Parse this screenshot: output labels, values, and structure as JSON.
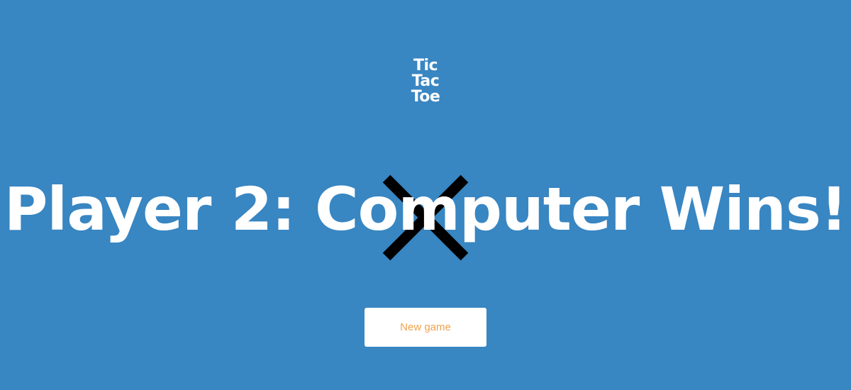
{
  "logo": {
    "lines": [
      "Tic",
      "Tac",
      "Toe"
    ]
  },
  "board": {
    "mark": "X",
    "mark_icon": "x-mark-icon",
    "mark_color": "#000000"
  },
  "message": {
    "text": "Player 2: Computer Wins!"
  },
  "actions": {
    "new_game_label": "New game"
  },
  "colors": {
    "background": "#3886c2",
    "text": "#ffffff",
    "button_background": "#ffffff",
    "button_text": "#f0a24c"
  }
}
